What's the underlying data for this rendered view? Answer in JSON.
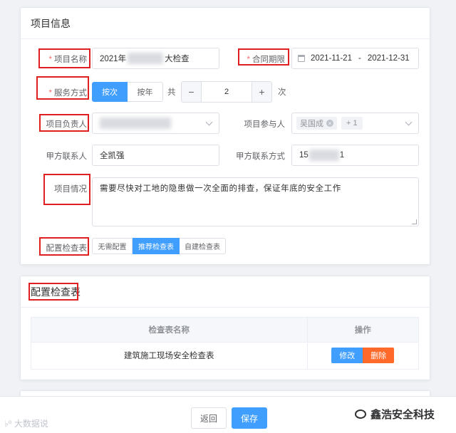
{
  "project_info": {
    "title": "项目信息",
    "project_name": {
      "label": "项目名称",
      "required": true,
      "value_prefix": "2021年",
      "value_suffix": "大检查"
    },
    "contract_period": {
      "label": "合同期限",
      "required": true,
      "start": "2021-11-21",
      "separator": "-",
      "end": "2021-12-31"
    },
    "service_mode": {
      "label": "服务方式",
      "required": true,
      "options": [
        "按次",
        "按年"
      ],
      "selected": "按次",
      "total_label": "共",
      "count": "2",
      "unit": "次",
      "minus": "−",
      "plus": "+"
    },
    "project_leader": {
      "label": "项目负责人"
    },
    "participants": {
      "label": "项目参与人",
      "tag": "吴国成",
      "tag_close": "×",
      "more": "+ 1"
    },
    "client_contact": {
      "label": "甲方联系人",
      "value": "全凯强"
    },
    "client_phone": {
      "label": "甲方联系方式",
      "value_prefix": "15",
      "value_suffix": "1"
    },
    "project_status": {
      "label": "项目情况",
      "value": "需要尽快对工地的隐患做一次全面的排查，保证年底的安全工作"
    },
    "checklist_config": {
      "label": "配置检查表",
      "options": [
        "无需配置",
        "推荐检查表",
        "自建检查表"
      ],
      "selected": "推荐检查表"
    }
  },
  "checklist_section": {
    "title": "配置检查表",
    "columns": [
      "检查表名称",
      "操作"
    ],
    "rows": [
      {
        "name": "建筑施工现场安全检查表",
        "edit": "修改",
        "delete": "删除"
      }
    ]
  },
  "footer": {
    "back": "返回",
    "save": "保存"
  },
  "watermark": {
    "left": "大数据说",
    "right": "鑫浩安全科技"
  },
  "colors": {
    "primary": "#409eff",
    "danger": "#ff6a2b",
    "annotation": "#e02020"
  }
}
